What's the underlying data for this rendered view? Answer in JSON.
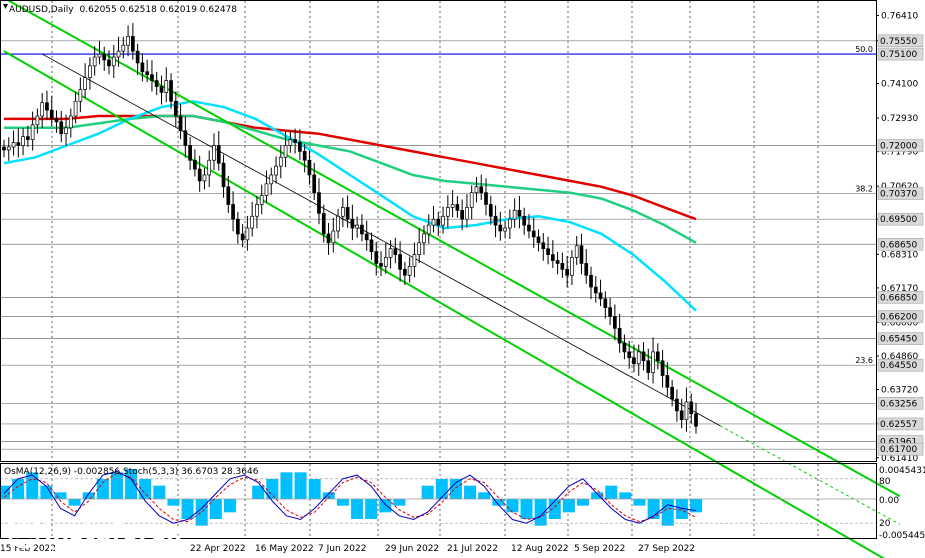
{
  "header": {
    "symbol": "AUDUSD,Daily",
    "ohlc": "0.62055 0.62518 0.62019 0.62478"
  },
  "indicator_header": "OsMA(12,26,9) -0.002856  Stoch(5,3,3) 36.6703 28.3646",
  "watermark": {
    "brand": "instaforex",
    "tagline": "Instant Forex Trading"
  },
  "price_ticks": [
    "0.76410",
    "0.75555",
    "0.74100",
    "0.72930",
    "0.71790",
    "0.70620",
    "0.69500",
    "0.68310",
    "0.67170",
    "0.66000",
    "0.64860",
    "0.63720",
    "0.62557",
    "0.61410"
  ],
  "level_labels": [
    {
      "text": "0.75550",
      "value": 0.7555
    },
    {
      "text": "0.75100",
      "value": 0.751
    },
    {
      "text": "0.72000",
      "value": 0.72
    },
    {
      "text": "0.70370",
      "value": 0.7037
    },
    {
      "text": "0.69500",
      "value": 0.695
    },
    {
      "text": "0.68650",
      "value": 0.6865
    },
    {
      "text": "0.66850",
      "value": 0.6685
    },
    {
      "text": "0.66200",
      "value": 0.662
    },
    {
      "text": "0.65450",
      "value": 0.6545
    },
    {
      "text": "0.64550",
      "value": 0.6455
    },
    {
      "text": "0.63256",
      "value": 0.63256
    },
    {
      "text": "0.62557",
      "value": 0.62557
    },
    {
      "text": "0.61961",
      "value": 0.61961
    },
    {
      "text": "0.61700",
      "value": 0.617
    }
  ],
  "fib_labels": [
    {
      "text": "50.0",
      "value": 0.751
    },
    {
      "text": "38.2",
      "value": 0.7037
    },
    {
      "text": "23.6",
      "value": 0.6455
    }
  ],
  "x_ticks": [
    "15 Feb 2022",
    "22 Apr 2022",
    "16 May 2022",
    "7 Jun 2022",
    "29 Jun 2022",
    "21 Jul 2022",
    "12 Aug 2022",
    "5 Sep 2022",
    "27 Sep 2022"
  ],
  "osc_ticks": [
    "0.0045431",
    "80",
    "0.00",
    "20",
    "-0.005445"
  ],
  "colors": {
    "channel": "#00d000",
    "ema200": "#e00000",
    "ema144": "#20d080",
    "ema50": "#00e0ff",
    "fib": "#0000e0",
    "candles": "#000000",
    "osma": "#00c0ff",
    "stoch_main": "#0000c0",
    "stoch_signal": "#e00000"
  },
  "chart_data": {
    "type": "candlestick",
    "symbol": "AUDUSD",
    "timeframe": "Daily",
    "last_bar": {
      "open": 0.62055,
      "high": 0.62518,
      "low": 0.62019,
      "close": 0.62478
    },
    "close_series": [
      0.7185,
      0.7195,
      0.721,
      0.72,
      0.723,
      0.722,
      0.727,
      0.73,
      0.7345,
      0.732,
      0.729,
      0.728,
      0.724,
      0.726,
      0.73,
      0.735,
      0.739,
      0.743,
      0.747,
      0.75,
      0.751,
      0.749,
      0.747,
      0.75,
      0.752,
      0.754,
      0.757,
      0.752,
      0.748,
      0.745,
      0.744,
      0.742,
      0.74,
      0.738,
      0.742,
      0.735,
      0.73,
      0.725,
      0.72,
      0.715,
      0.712,
      0.708,
      0.71,
      0.715,
      0.72,
      0.714,
      0.706,
      0.7,
      0.695,
      0.69,
      0.688,
      0.692,
      0.696,
      0.7,
      0.703,
      0.707,
      0.71,
      0.713,
      0.716,
      0.72,
      0.722,
      0.721,
      0.718,
      0.715,
      0.71,
      0.704,
      0.697,
      0.69,
      0.687,
      0.691,
      0.696,
      0.699,
      0.695,
      0.692,
      0.693,
      0.69,
      0.688,
      0.684,
      0.68,
      0.679,
      0.682,
      0.685,
      0.683,
      0.678,
      0.676,
      0.679,
      0.683,
      0.687,
      0.69,
      0.693,
      0.695,
      0.693,
      0.696,
      0.699,
      0.7,
      0.698,
      0.695,
      0.699,
      0.704,
      0.706,
      0.704,
      0.7,
      0.696,
      0.693,
      0.691,
      0.692,
      0.695,
      0.698,
      0.696,
      0.693,
      0.691,
      0.689,
      0.687,
      0.685,
      0.683,
      0.681,
      0.68,
      0.678,
      0.676,
      0.682,
      0.686,
      0.68,
      0.676,
      0.672,
      0.67,
      0.668,
      0.665,
      0.662,
      0.658,
      0.653,
      0.65,
      0.648,
      0.646,
      0.65,
      0.647,
      0.643,
      0.65,
      0.647,
      0.642,
      0.638,
      0.634,
      0.63,
      0.627,
      0.633,
      0.629,
      0.6248
    ],
    "ema50": [
      0.714,
      0.716,
      0.72,
      0.724,
      0.729,
      0.733,
      0.735,
      0.733,
      0.729,
      0.723,
      0.717,
      0.71,
      0.703,
      0.696,
      0.692,
      0.693,
      0.695,
      0.696,
      0.694,
      0.69,
      0.683,
      0.674,
      0.664
    ],
    "ema144": [
      0.726,
      0.726,
      0.726,
      0.7275,
      0.729,
      0.73,
      0.73,
      0.728,
      0.725,
      0.722,
      0.72,
      0.718,
      0.714,
      0.71,
      0.708,
      0.707,
      0.706,
      0.705,
      0.704,
      0.702,
      0.698,
      0.693,
      0.687
    ],
    "ema200": [
      0.729,
      0.729,
      0.729,
      0.73,
      0.73,
      0.73,
      0.73,
      0.728,
      0.726,
      0.725,
      0.724,
      0.722,
      0.72,
      0.718,
      0.716,
      0.714,
      0.712,
      0.71,
      0.708,
      0.706,
      0.703,
      0.699,
      0.695
    ],
    "channel_lines": [
      {
        "name": "upper",
        "from": {
          "bar": 0,
          "price": 0.77
        },
        "to": {
          "bar": 150,
          "price": 0.635
        }
      },
      {
        "name": "middle",
        "from": {
          "bar": 8,
          "price": 0.751
        },
        "to": {
          "bar": 150,
          "price": 0.625
        }
      },
      {
        "name": "lower",
        "from": {
          "bar": 0,
          "price": 0.752
        },
        "to": {
          "bar": 150,
          "price": 0.612
        }
      }
    ],
    "fib_level": {
      "value": 0.751,
      "label": "50.0"
    },
    "y_range": [
      0.613,
      0.769
    ],
    "osma": [
      0.002,
      0.003,
      0.004,
      0.002,
      0.001,
      -0.001,
      0.001,
      0.003,
      0.004,
      0.0045,
      0.003,
      0.002,
      -0.001,
      -0.003,
      -0.004,
      -0.003,
      -0.002,
      0.0,
      0.002,
      0.003,
      0.004,
      0.004,
      0.003,
      0.001,
      -0.001,
      -0.003,
      -0.003,
      -0.002,
      -0.001,
      0.0,
      0.002,
      0.003,
      0.003,
      0.002,
      0.001,
      -0.001,
      -0.002,
      -0.003,
      -0.004,
      -0.003,
      -0.002,
      -0.001,
      0.001,
      0.002,
      0.001,
      -0.001,
      -0.003,
      -0.004,
      -0.003,
      -0.002
    ],
    "stoch_main": [
      60,
      80,
      85,
      70,
      40,
      30,
      60,
      85,
      90,
      80,
      50,
      30,
      20,
      25,
      40,
      60,
      80,
      85,
      75,
      50,
      30,
      25,
      40,
      60,
      80,
      85,
      70,
      45,
      30,
      25,
      35,
      55,
      75,
      85,
      70,
      45,
      25,
      20,
      30,
      50,
      70,
      80,
      60,
      40,
      25,
      20,
      30,
      45,
      40,
      37
    ],
    "stoch_signal": [
      55,
      70,
      80,
      75,
      50,
      35,
      50,
      75,
      88,
      82,
      60,
      40,
      25,
      22,
      35,
      55,
      72,
      82,
      78,
      58,
      38,
      28,
      35,
      55,
      75,
      82,
      75,
      55,
      38,
      28,
      32,
      48,
      68,
      80,
      75,
      55,
      35,
      25,
      28,
      42,
      62,
      75,
      65,
      45,
      30,
      22,
      28,
      40,
      38,
      28
    ],
    "osc_y_range": [
      0,
      100
    ]
  }
}
